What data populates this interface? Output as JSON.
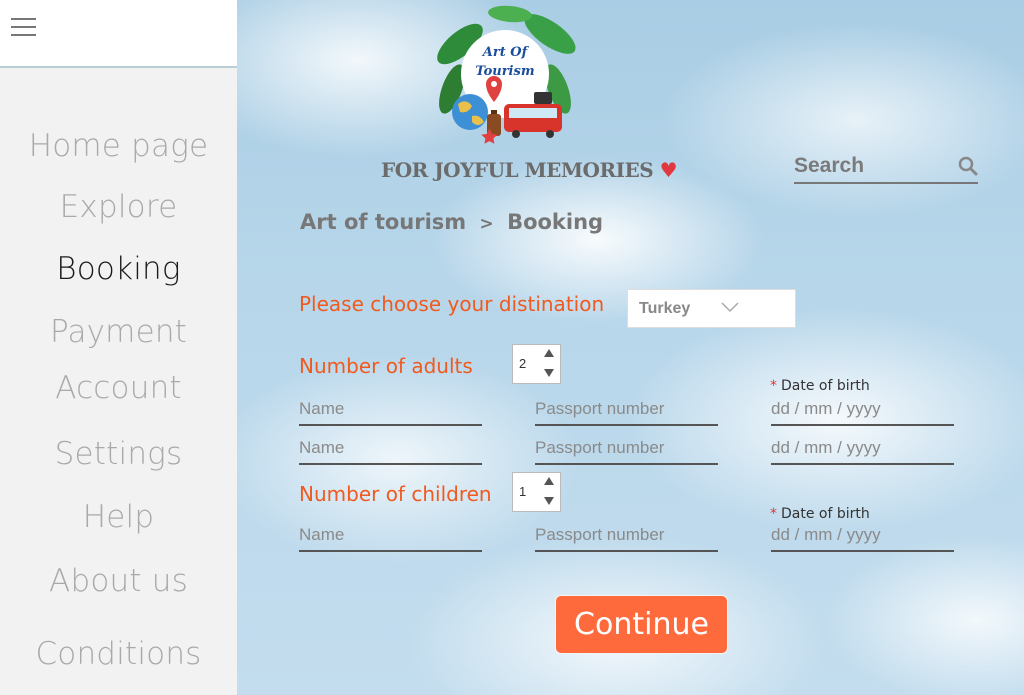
{
  "sidebar": {
    "items": [
      {
        "label": "Home page"
      },
      {
        "label": "Explore"
      },
      {
        "label": "Booking"
      },
      {
        "label": "Payment"
      },
      {
        "label": "Account"
      },
      {
        "label": "Settings"
      },
      {
        "label": "Help"
      },
      {
        "label": "About us"
      },
      {
        "label": "Conditions"
      }
    ],
    "active": "Booking"
  },
  "header": {
    "logo_text_line1": "Art Of",
    "logo_text_line2": "Tourism",
    "tagline": "FOR JOYFUL MEMORIES",
    "tagline_symbol": "♥",
    "search_placeholder": "Search"
  },
  "breadcrumb": {
    "root": "Art of tourism",
    "separator": ">",
    "current": "Booking"
  },
  "form": {
    "destination_label": "Please choose your distination",
    "destination_value": "Turkey",
    "adults_label": "Number of adults",
    "adults_value": "2",
    "children_label": "Number of children",
    "children_value": "1",
    "name_placeholder": "Name",
    "passport_placeholder": "Passport number",
    "date_placeholder": "dd / mm / yyyy",
    "dob_label": "Date of birth",
    "required_mark": "*",
    "continue_label": "Continue"
  },
  "colors": {
    "accent": "#ff6a3d",
    "label_orange": "#f05a1e",
    "heart": "#e0383e"
  }
}
